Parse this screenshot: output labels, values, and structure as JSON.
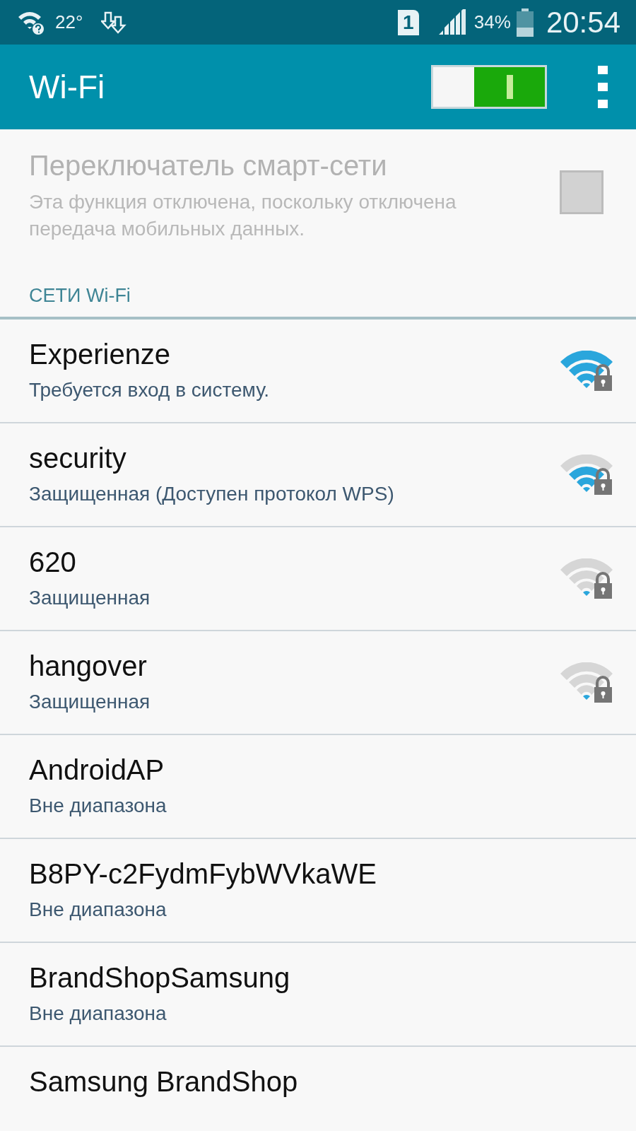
{
  "status_bar": {
    "temperature": "22°",
    "sim": "1",
    "battery": "34%",
    "time": "20:54"
  },
  "app_bar": {
    "title": "Wi-Fi",
    "wifi_on": true
  },
  "smart_switch": {
    "title": "Переключатель смарт-сети",
    "description": "Эта функция отключена, поскольку отключена передача мобильных данных.",
    "checked": false,
    "disabled": true
  },
  "section_header": "СЕТИ Wi-Fi",
  "networks": [
    {
      "name": "Experienze",
      "status": "Требуется вход в систему.",
      "kind": "full",
      "secured": true
    },
    {
      "name": "security",
      "status": "Защищенная (Доступен протокол WPS)",
      "kind": "good",
      "secured": true
    },
    {
      "name": "620",
      "status": "Защищенная",
      "kind": "weak",
      "secured": true
    },
    {
      "name": "hangover",
      "status": "Защищенная",
      "kind": "weak",
      "secured": true
    },
    {
      "name": "AndroidAP",
      "status": "Вне диапазона"
    },
    {
      "name": "B8PY-c2FydmFybWVkaWE",
      "status": "Вне диапазона"
    },
    {
      "name": "BrandShopSamsung",
      "status": "Вне диапазона"
    },
    {
      "name": "Samsung BrandShop"
    }
  ]
}
